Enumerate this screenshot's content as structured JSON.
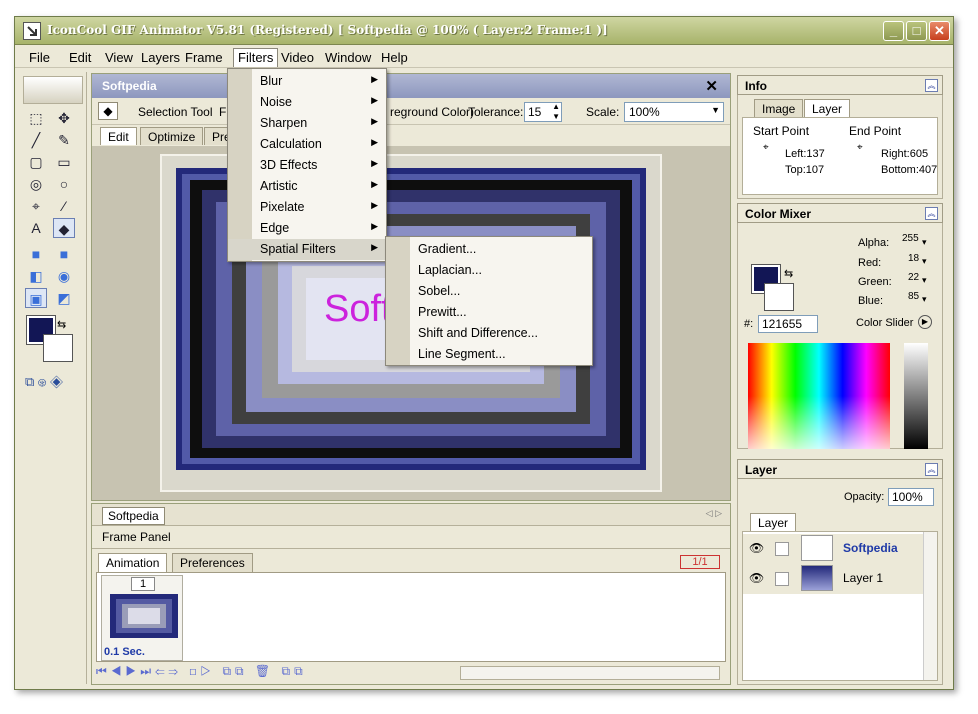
{
  "window": {
    "title": "IconCool GIF Animator V5.81 (Registered) [ Softpedia @ 100% ( Layer:2 Frame:1 )]",
    "buttons": {
      "minimize": "_",
      "maximize": "□",
      "close": "✕"
    }
  },
  "menubar": [
    "File",
    "Edit",
    "View",
    "Layers",
    "Frame",
    "Filters",
    "Video",
    "Window",
    "Help"
  ],
  "document": {
    "title": "Softpedia",
    "toolbar": {
      "tool_name": "Selection Tool",
      "hidden_prefix": "F",
      "option_text": "reground Color)",
      "tolerance_label": "Tolerance:",
      "tolerance_value": "15",
      "scale_label": "Scale:",
      "scale_value": "100%"
    },
    "tabs": [
      "Edit",
      "Optimize",
      "Pre"
    ],
    "canvas_text": "Soft"
  },
  "filters_menu": {
    "items": [
      "Blur",
      "Noise",
      "Sharpen",
      "Calculation",
      "3D Effects",
      "Artistic",
      "Pixelate",
      "Edge",
      "Spatial Filters"
    ]
  },
  "spatial_submenu": {
    "items": [
      "Gradient...",
      "Laplacian...",
      "Sobel...",
      "Prewitt...",
      "Shift and Difference...",
      "Line Segment..."
    ]
  },
  "bottom": {
    "doc_tab": "Softpedia",
    "frame_panel_label": "Frame Panel",
    "tabs": [
      "Animation",
      "Preferences"
    ],
    "counter": "1/1",
    "frame_number": "1",
    "frame_delay": "0.1 Sec."
  },
  "info_panel": {
    "title": "Info",
    "tabs": [
      "Image",
      "Layer"
    ],
    "start_point_label": "Start Point",
    "end_point_label": "End Point",
    "left": "Left:137",
    "top": "Top:107",
    "right": "Right:605",
    "bottom": "Bottom:407"
  },
  "color_mixer": {
    "title": "Color Mixer",
    "alpha_label": "Alpha:",
    "alpha_value": "255",
    "red_label": "Red:",
    "red_value": "18",
    "green_label": "Green:",
    "green_value": "22",
    "blue_label": "Blue:",
    "blue_value": "85",
    "hex_label": "#:",
    "hex_value": "121655",
    "slider_label": "Color Slider",
    "current_color": "#121655"
  },
  "layer_panel": {
    "title": "Layer",
    "opacity_label": "Opacity:",
    "opacity_value": "100%",
    "tab": "Layer",
    "layers": [
      "Softpedia",
      "Layer 1"
    ]
  }
}
